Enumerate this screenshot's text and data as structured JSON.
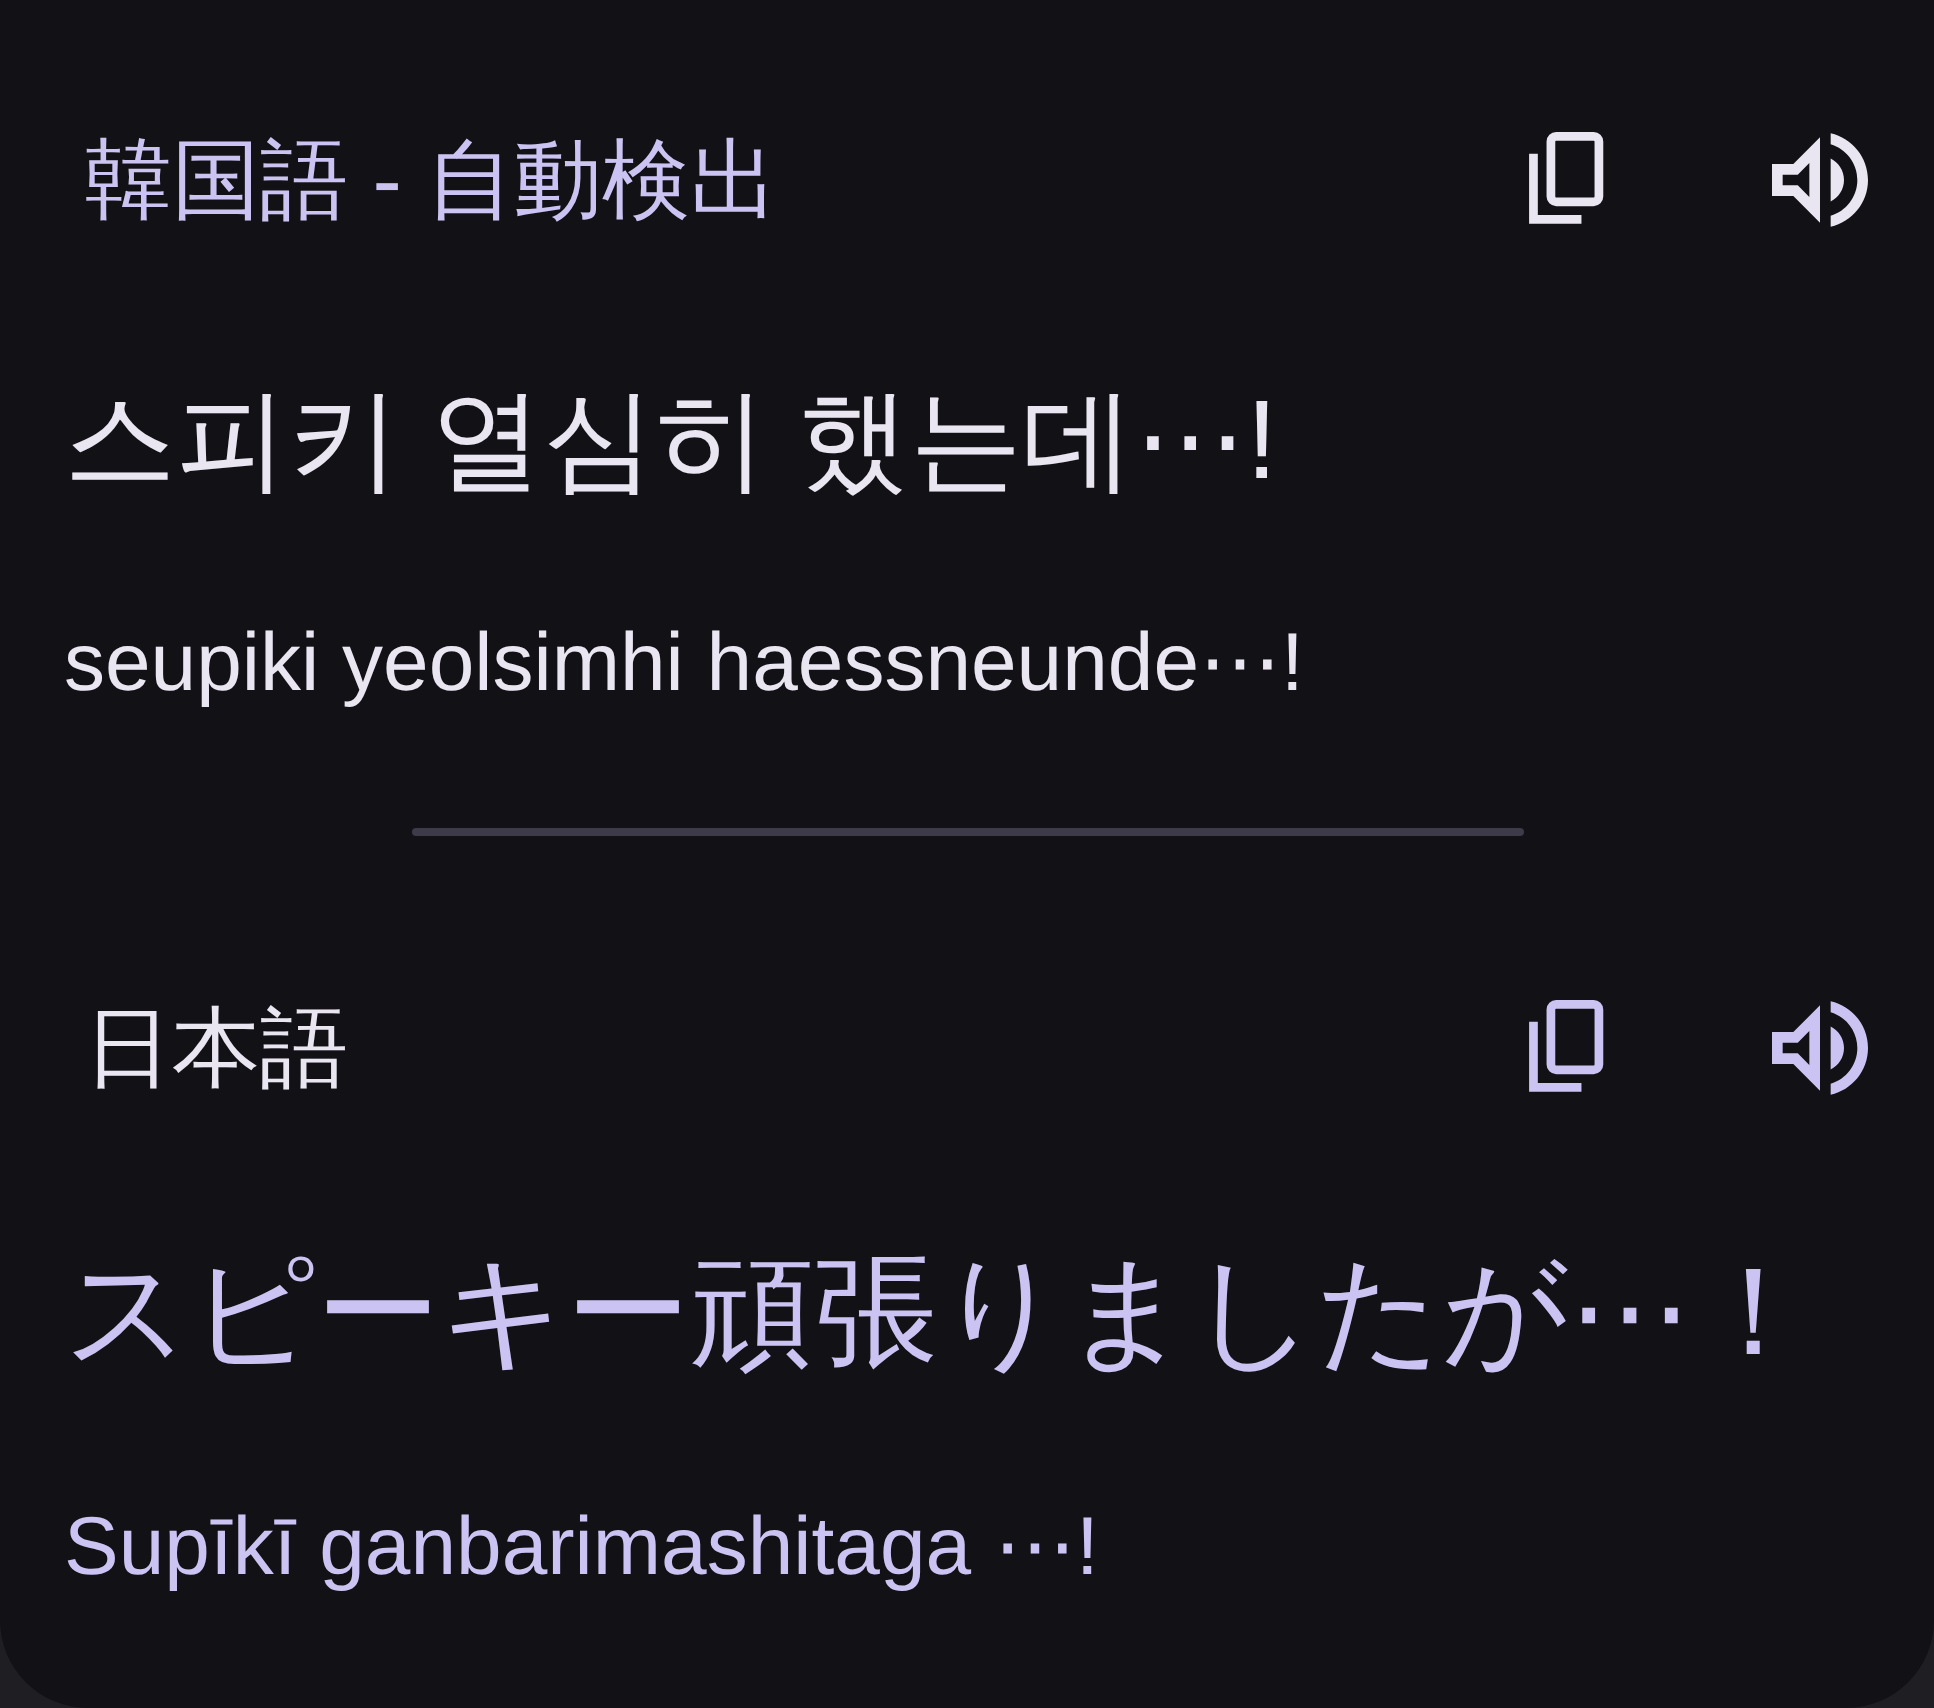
{
  "sections": [
    {
      "kind": "source",
      "language": "韓国語 - 自動検出",
      "text": "스피키 열심히 했는데⋯!",
      "romanization": "seupiki yeolsimhi haessneunde⋯!"
    },
    {
      "kind": "target",
      "language": "日本語",
      "text": "スピーキー頑張りましたが⋯！",
      "romanization": "Supīkī ganbarimashitaga ⋯!"
    }
  ]
}
